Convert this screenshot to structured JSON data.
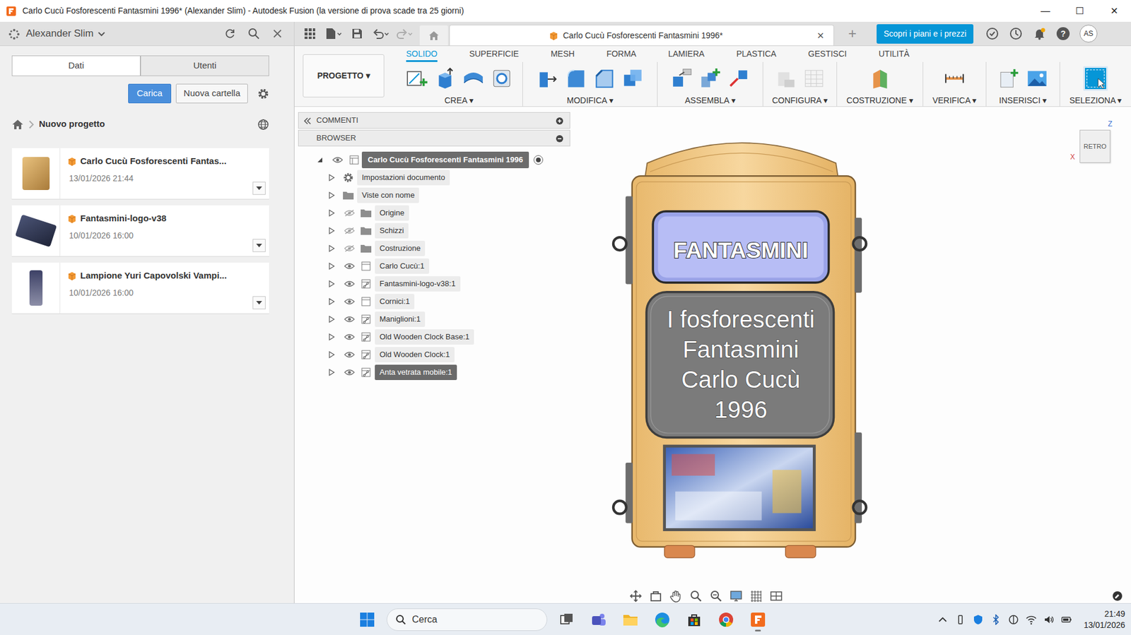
{
  "window": {
    "title": "Carlo Cucù Fosforescenti Fantasmini 1996* (Alexander Slim) - Autodesk Fusion (la versione di prova scade tra 25 giorni)",
    "controls": [
      "—",
      "☐",
      "✕"
    ]
  },
  "app_bar": {
    "user": "Alexander Slim",
    "document_tab": {
      "title": "Carlo Cucù Fosforescenti Fantasmini 1996*",
      "close": "×"
    },
    "new_tab": "+",
    "plans_button": "Scopri i piani e i prezzi",
    "help": "?",
    "avatar": "AS"
  },
  "data_panel": {
    "tabs": [
      {
        "label": "Dati",
        "selected": true
      },
      {
        "label": "Utenti",
        "selected": false
      }
    ],
    "upload_button": "Carica",
    "new_folder_button": "Nuova cartella",
    "project": "Nuovo progetto",
    "files": [
      {
        "name": "Carlo Cucù Fosforescenti Fantas...",
        "date": "13/01/2026 21:44"
      },
      {
        "name": "Fantasmini-logo-v38",
        "date": "10/01/2026 16:00"
      },
      {
        "name": "Lampione Yuri Capovolski Vampi...",
        "date": "10/01/2026 16:00"
      }
    ]
  },
  "ribbon": {
    "workspace_menu": "PROGETTO ▾",
    "tabs": [
      {
        "label": "SOLIDO",
        "selected": true
      },
      {
        "label": "SUPERFICIE",
        "selected": false
      },
      {
        "label": "MESH",
        "selected": false
      },
      {
        "label": "FORMA",
        "selected": false
      },
      {
        "label": "LAMIERA",
        "selected": false
      },
      {
        "label": "PLASTICA",
        "selected": false
      },
      {
        "label": "GESTISCI",
        "selected": false
      },
      {
        "label": "UTILITÀ",
        "selected": false
      }
    ],
    "groups": [
      {
        "label": "CREA ▾",
        "disabled": false
      },
      {
        "label": "MODIFICA ▾",
        "disabled": false
      },
      {
        "label": "ASSEMBLA ▾",
        "disabled": false
      },
      {
        "label": "CONFIGURA ▾",
        "disabled": true
      },
      {
        "label": "COSTRUZIONE ▾",
        "disabled": false
      },
      {
        "label": "VERIFICA ▾",
        "disabled": false
      },
      {
        "label": "INSERISCI ▾",
        "disabled": false
      },
      {
        "label": "SELEZIONA ▾",
        "disabled": false
      }
    ]
  },
  "browser": {
    "comments": "COMMENTI",
    "title": "BROWSER",
    "root": {
      "label": "Carlo Cucù Fosforescenti Fantasmini 1996",
      "expanded": true,
      "visible": true,
      "active": true
    },
    "items": [
      {
        "label": "Impostazioni documento",
        "kind": "settings",
        "expanded": false,
        "selected": false
      },
      {
        "label": "Viste con nome",
        "kind": "views",
        "expanded": false,
        "selected": false
      },
      {
        "label": "Origine",
        "kind": "folder",
        "expanded": false,
        "visible": false,
        "selected": false
      },
      {
        "label": "Schizzi",
        "kind": "folder",
        "expanded": false,
        "visible": false,
        "selected": false
      },
      {
        "label": "Costruzione",
        "kind": "folder",
        "expanded": false,
        "visible": false,
        "selected": false
      },
      {
        "label": "Carlo Cucù:1",
        "kind": "component",
        "expanded": false,
        "visible": true,
        "selected": false
      },
      {
        "label": "Fantasmini-logo-v38:1",
        "kind": "linked",
        "expanded": false,
        "visible": true,
        "selected": false
      },
      {
        "label": "Cornici:1",
        "kind": "component",
        "expanded": false,
        "visible": true,
        "selected": false
      },
      {
        "label": "Maniglioni:1",
        "kind": "linked",
        "expanded": false,
        "visible": true,
        "selected": false
      },
      {
        "label": "Old Wooden Clock Base:1",
        "kind": "linked",
        "expanded": false,
        "visible": true,
        "selected": false
      },
      {
        "label": "Old Wooden Clock:1",
        "kind": "linked",
        "expanded": false,
        "visible": true,
        "selected": false
      },
      {
        "label": "Anta vetrata mobile:1",
        "kind": "linked",
        "expanded": false,
        "visible": true,
        "selected": true
      }
    ]
  },
  "viewcube": {
    "face": "RETRO",
    "axis_z": "Z",
    "axis_x": "X"
  },
  "model": {
    "logo": "FANTASMINI",
    "lines": [
      "I fosforescenti",
      "Fantasmini",
      "Carlo Cucù",
      "1996"
    ]
  },
  "taskbar": {
    "search": "Cerca",
    "time": "21:49",
    "date": "13/01/2026"
  }
}
